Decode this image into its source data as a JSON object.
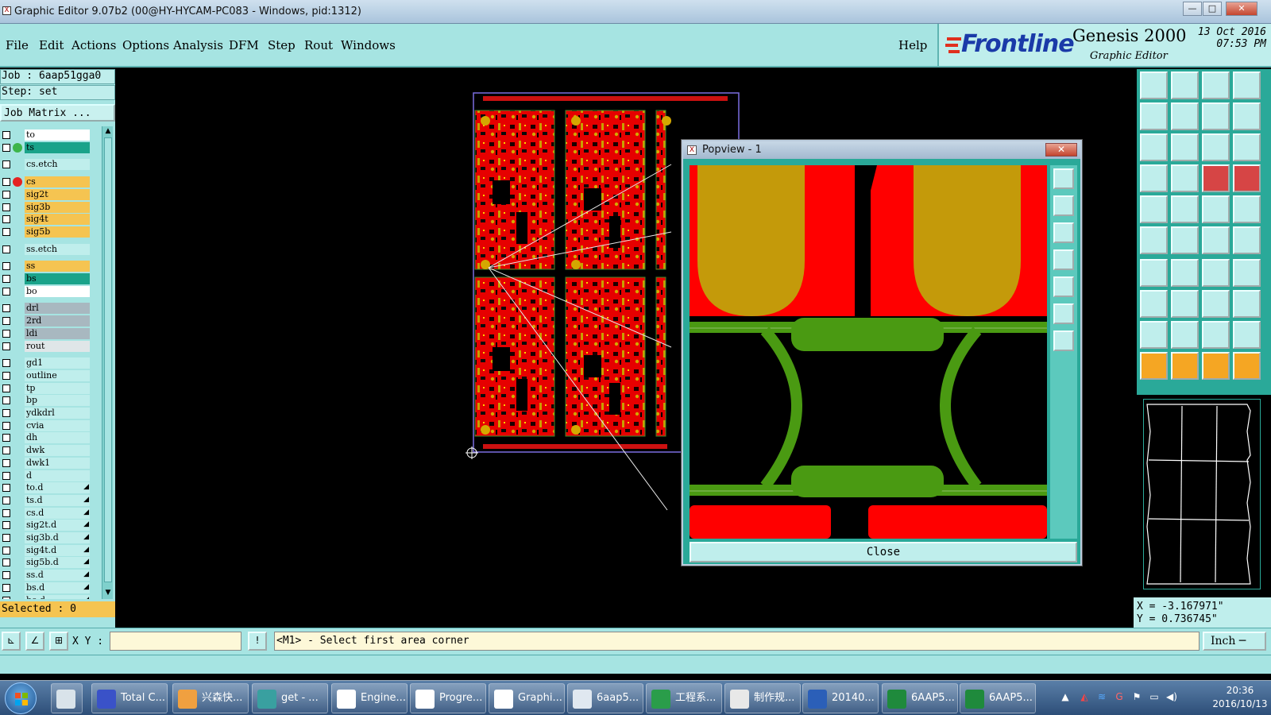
{
  "window": {
    "title": "Graphic Editor 9.07b2 (00@HY-HYCAM-PC083 - Windows, pid:1312)",
    "minimize": "—",
    "maximize": "□",
    "close": "✕"
  },
  "menu": {
    "file": "File",
    "edit": "Edit",
    "actions": "Actions",
    "options": "Options",
    "analysis": "Analysis",
    "dfm": "DFM",
    "step": "Step",
    "rout": "Rout",
    "windows": "Windows",
    "help": "Help"
  },
  "brand": {
    "logo": "Frontline",
    "product": "Genesis 2000",
    "subtitle": "Graphic Editor",
    "date": "13 Oct 2016",
    "time": "07:53 PM"
  },
  "job": {
    "job_line": "Job : 6aap51gga0",
    "step_line": "Step: set",
    "matrix_button": "Job Matrix ..."
  },
  "layers": [
    {
      "name": "to",
      "color": "#ffffff",
      "dot": ""
    },
    {
      "name": "ts",
      "color": "#1aa38a",
      "dot": "#3db54a"
    },
    {
      "name": "cs.etch",
      "color": "#bfeeec",
      "dot": ""
    },
    {
      "name": "cs",
      "color": "#f5c451",
      "dot": "#e52222"
    },
    {
      "name": "sig2t",
      "color": "#f5c451",
      "dot": ""
    },
    {
      "name": "sig3b",
      "color": "#f5c451",
      "dot": ""
    },
    {
      "name": "sig4t",
      "color": "#f5c451",
      "dot": ""
    },
    {
      "name": "sig5b",
      "color": "#f5c451",
      "dot": ""
    },
    {
      "name": "ss.etch",
      "color": "#bfeeec",
      "dot": ""
    },
    {
      "name": "ss",
      "color": "#f5c451",
      "dot": ""
    },
    {
      "name": "bs",
      "color": "#1aa38a",
      "dot": ""
    },
    {
      "name": "bo",
      "color": "#ffffff",
      "dot": ""
    },
    {
      "name": "drl",
      "color": "#a8b8c0",
      "dot": ""
    },
    {
      "name": "2rd",
      "color": "#a8b8c0",
      "dot": ""
    },
    {
      "name": "ldi",
      "color": "#a8b8c0",
      "dot": ""
    },
    {
      "name": "rout",
      "color": "#dfe6e8",
      "dot": ""
    },
    {
      "name": "gd1",
      "color": "#bfeeec",
      "dot": ""
    },
    {
      "name": "outline",
      "color": "#bfeeec",
      "dot": ""
    },
    {
      "name": "tp",
      "color": "#bfeeec",
      "dot": ""
    },
    {
      "name": "bp",
      "color": "#bfeeec",
      "dot": ""
    },
    {
      "name": "ydkdrl",
      "color": "#bfeeec",
      "dot": ""
    },
    {
      "name": "cvia",
      "color": "#bfeeec",
      "dot": ""
    },
    {
      "name": "dh",
      "color": "#bfeeec",
      "dot": ""
    },
    {
      "name": "dwk",
      "color": "#bfeeec",
      "dot": ""
    },
    {
      "name": "dwk1",
      "color": "#bfeeec",
      "dot": ""
    },
    {
      "name": "d",
      "color": "#bfeeec",
      "dot": ""
    },
    {
      "name": "to.d",
      "color": "#bfeeec",
      "dot": "",
      "marker": "◢"
    },
    {
      "name": "ts.d",
      "color": "#bfeeec",
      "dot": "",
      "marker": "◢"
    },
    {
      "name": "cs.d",
      "color": "#bfeeec",
      "dot": "",
      "marker": "◢"
    },
    {
      "name": "sig2t.d",
      "color": "#bfeeec",
      "dot": "",
      "marker": "◢"
    },
    {
      "name": "sig3b.d",
      "color": "#bfeeec",
      "dot": "",
      "marker": "◢"
    },
    {
      "name": "sig4t.d",
      "color": "#bfeeec",
      "dot": "",
      "marker": "◢"
    },
    {
      "name": "sig5b.d",
      "color": "#bfeeec",
      "dot": "",
      "marker": "◢"
    },
    {
      "name": "ss.d",
      "color": "#bfeeec",
      "dot": "",
      "marker": "◢"
    },
    {
      "name": "bs.d",
      "color": "#bfeeec",
      "dot": "",
      "marker": "◢"
    },
    {
      "name": "bo.d",
      "color": "#bfeeec",
      "dot": "",
      "marker": "◢"
    }
  ],
  "selected_label": "Selected : 0",
  "popview": {
    "title": "Popview - 1",
    "close_x": "✕",
    "close_button": "Close"
  },
  "coords": {
    "x": "X = -3.167971\"",
    "y": "Y = 0.736745\""
  },
  "bottom": {
    "xy_label": "X Y :",
    "xy_value": "",
    "info_button": "!",
    "message": "<M1> - Select first area corner",
    "units": "Inch ─"
  },
  "taskbar": {
    "items": [
      {
        "label": "",
        "icon": "calculator-icon",
        "color": "#d9e3ea"
      },
      {
        "label": "Total C...",
        "icon": "floppy-icon",
        "color": "#3a52c8"
      },
      {
        "label": "兴森快...",
        "icon": "shell-icon",
        "color": "#f0a040"
      },
      {
        "label": "get - ...",
        "icon": "globe-icon",
        "color": "#39a0a0"
      },
      {
        "label": "Engine...",
        "icon": "x-window-icon",
        "color": "#ffffff"
      },
      {
        "label": "Progre...",
        "icon": "x-window-icon",
        "color": "#ffffff"
      },
      {
        "label": "Graphi...",
        "icon": "x-window-icon",
        "color": "#ffffff"
      },
      {
        "label": "6aap5...",
        "icon": "document-a-icon",
        "color": "#e0e8f0"
      },
      {
        "label": "工程系...",
        "icon": "f-logo-icon",
        "color": "#2a9d4a"
      },
      {
        "label": "制作规...",
        "icon": "notepad-icon",
        "color": "#e8e8e8"
      },
      {
        "label": "20140...",
        "icon": "word-icon",
        "color": "#2b5fb8"
      },
      {
        "label": "6AAP5...",
        "icon": "excel-icon",
        "color": "#1f8a3c"
      },
      {
        "label": "6AAP5...",
        "icon": "excel-icon",
        "color": "#1f8a3c"
      }
    ],
    "time": "20:36",
    "date": "2016/10/13"
  },
  "colors": {
    "panel": "#a6e4e2",
    "copper_red": "#ff0000",
    "pad_gold": "#c49a0a",
    "trace_green": "#4a9a12"
  }
}
